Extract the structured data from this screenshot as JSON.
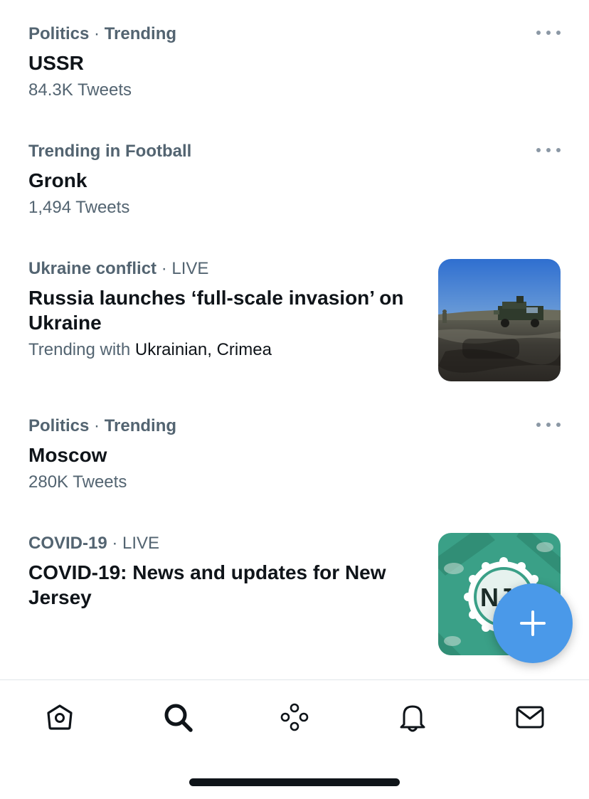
{
  "trends": [
    {
      "category": "Politics",
      "separator": " · ",
      "qualifier": "Trending",
      "title": "USSR",
      "meta": "84.3K Tweets"
    },
    {
      "category": "Trending in Football",
      "title": "Gronk",
      "meta": "1,494 Tweets"
    },
    {
      "category": "Ukraine conflict",
      "separator": " · ",
      "status": "LIVE",
      "title": "Russia launches ‘full-scale invasion’ on Ukraine",
      "meta_prefix": "Trending with ",
      "meta_terms": "Ukrainian, Crimea"
    },
    {
      "category": "Politics",
      "separator": " · ",
      "qualifier": "Trending",
      "title": "Moscow",
      "meta": "280K Tweets"
    },
    {
      "category": "COVID-19",
      "separator": " · ",
      "status": "LIVE",
      "title": "COVID-19: News and updates for New Jersey",
      "badge_text": "NJ"
    }
  ],
  "icons": {
    "more": "more-horizontal-icon",
    "compose": "plus-icon",
    "tabs": [
      "home-icon",
      "search-icon",
      "spaces-icon",
      "bell-icon",
      "mail-icon"
    ]
  },
  "colors": {
    "accent": "#4a99e9",
    "secondary_text": "#536471",
    "primary_text": "#0f1419",
    "covid_green": "#3aa087"
  }
}
